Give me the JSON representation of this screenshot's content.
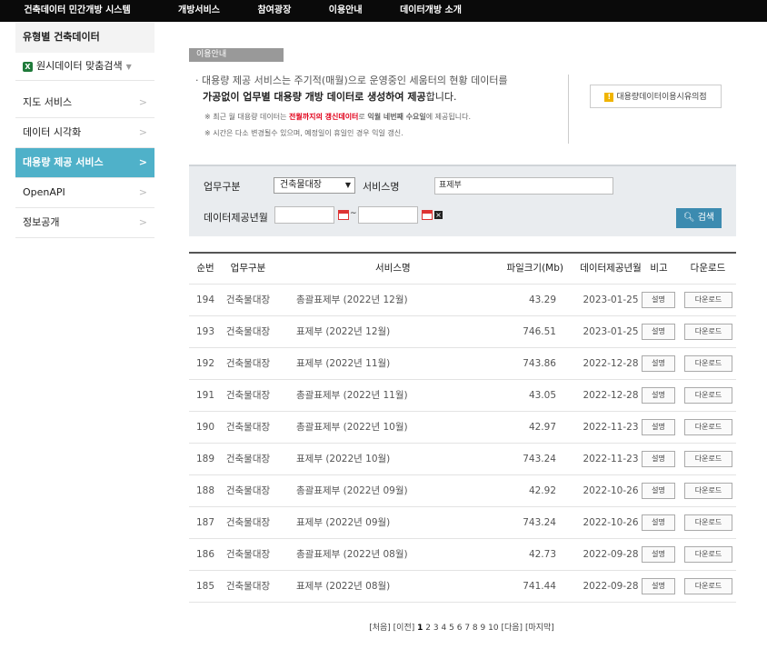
{
  "topnav": {
    "brand": "건축데이터 민간개방 시스템",
    "menu": [
      "개방서비스",
      "참여광장",
      "이용안내",
      "데이터개방 소개"
    ]
  },
  "sidebar": {
    "heading": "유형별 건축데이터",
    "sub": "원시데이터 맞춤검색",
    "items": [
      {
        "label": "지도 서비스"
      },
      {
        "label": "데이터 시각화"
      },
      {
        "label": "대용량 제공 서비스"
      },
      {
        "label": "OpenAPI"
      },
      {
        "label": "정보공개"
      }
    ]
  },
  "section_tag": "이용안내",
  "info": {
    "line1": "· 대용량 제공 서비스는 주기적(매월)으로 운영중인 세움터의 현황 데이터를",
    "line2_bold": "가공없이 업무별 대용량 개방 데이터로 생성하여 제공",
    "line2_rest": "합니다.",
    "note1_a": "※ 최근 월 대용량 데이터는 ",
    "note1_red": "전월까지의 갱신데이터",
    "note1_b": "로 ",
    "note1_bold": "익월 네번째 수요일",
    "note1_c": "에 제공됩니다.",
    "note2": "※ 시간은 다소 변경될수 있으며, 예정일이 휴일인 경우 익일 갱신."
  },
  "notice_button": "대용량데이터이용시유의점",
  "search": {
    "category_label": "업무구분",
    "category_value": "건축물대장",
    "service_label": "서비스명",
    "service_value": "표제부",
    "date_label": "데이터제공년월",
    "date_from": "",
    "date_to": "",
    "tilde": "~",
    "button": "검색"
  },
  "table": {
    "headers": [
      "순번",
      "업무구분",
      "서비스명",
      "파일크기(Mb)",
      "데이터제공년월",
      "비고",
      "다운로드"
    ],
    "desc_label": "설명",
    "download_label": "다운로드",
    "rows": [
      {
        "no": "194",
        "cat": "건축물대장",
        "svc": "총괄표제부 (2022년 12월)",
        "size": "43.29",
        "date": "2023-01-25"
      },
      {
        "no": "193",
        "cat": "건축물대장",
        "svc": "표제부 (2022년 12월)",
        "size": "746.51",
        "date": "2023-01-25"
      },
      {
        "no": "192",
        "cat": "건축물대장",
        "svc": "표제부 (2022년 11월)",
        "size": "743.86",
        "date": "2022-12-28"
      },
      {
        "no": "191",
        "cat": "건축물대장",
        "svc": "총괄표제부 (2022년 11월)",
        "size": "43.05",
        "date": "2022-12-28"
      },
      {
        "no": "190",
        "cat": "건축물대장",
        "svc": "총괄표제부 (2022년 10월)",
        "size": "42.97",
        "date": "2022-11-23"
      },
      {
        "no": "189",
        "cat": "건축물대장",
        "svc": "표제부 (2022년 10월)",
        "size": "743.24",
        "date": "2022-11-23"
      },
      {
        "no": "188",
        "cat": "건축물대장",
        "svc": "총괄표제부 (2022년 09월)",
        "size": "42.92",
        "date": "2022-10-26"
      },
      {
        "no": "187",
        "cat": "건축물대장",
        "svc": "표제부 (2022년 09월)",
        "size": "743.24",
        "date": "2022-10-26"
      },
      {
        "no": "186",
        "cat": "건축물대장",
        "svc": "총괄표제부 (2022년 08월)",
        "size": "42.73",
        "date": "2022-09-28"
      },
      {
        "no": "185",
        "cat": "건축물대장",
        "svc": "표제부 (2022년 08월)",
        "size": "741.44",
        "date": "2022-09-28"
      }
    ]
  },
  "pager": {
    "first": "[처음]",
    "prev": "[이전]",
    "current": "1",
    "pages": [
      "2",
      "3",
      "4",
      "5",
      "6",
      "7",
      "8",
      "9",
      "10"
    ],
    "next": "[다음]",
    "last": "[마지막]"
  }
}
